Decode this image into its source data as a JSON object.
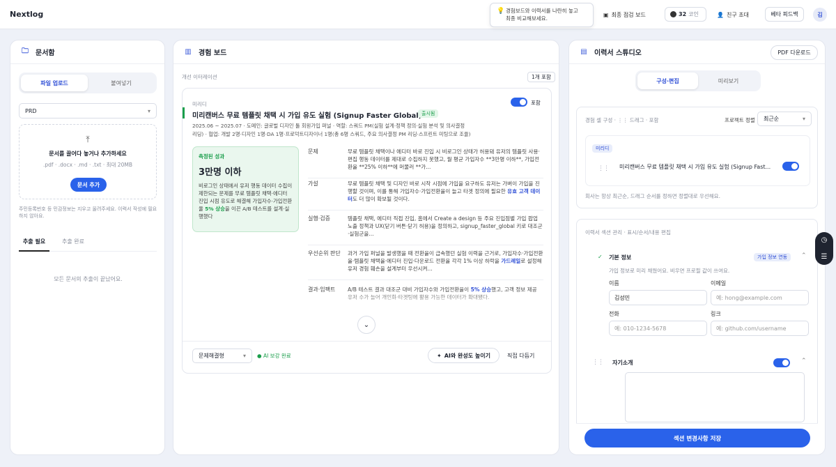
{
  "app": {
    "title": "Nextlog"
  },
  "topbar": {
    "tooltip_line1": "경험보드와 이력서를 나란히 놓고",
    "tooltip_line2": "최종 비교해보세요.",
    "final_check_board": "최종 점검 보드",
    "coins_count": "32",
    "coins_label": "코인",
    "invite_friend": "친구 초대",
    "beta_feedback": "베타 피드백",
    "avatar_initial": "김"
  },
  "library": {
    "title": "문서함",
    "tab_upload": "파일 업로드",
    "tab_paste": "붙여넣기",
    "doc_type": "PRD",
    "drop_title": "문서를 끌어다 놓거나 추가하세요",
    "drop_formats": ".pdf · .docx · .md · .txt · 최대 20MB",
    "add_doc_button": "문서 추가",
    "privacy_note": "주민등록번호 등 민감정보는 지우고 올려주세요. 이력서 작성에 필요하지 않아요.",
    "tab_needs_extraction": "추출 필요",
    "tab_extracted": "추출 완료",
    "empty_message": "모든 문서의 추출이 끝났어요."
  },
  "board": {
    "title": "경험 보드",
    "section_label": "개선 이터레이션",
    "included_count": "1개 포함",
    "card": {
      "small_label": "미리디",
      "include_label": "포함",
      "title": "미리캔버스 무료 템플릿 채택 시 가입 유도 실험 (Signup Faster Global)",
      "status_badge": "출시됨",
      "meta_line1": "2025.06 ~ 2025.07 · 도메인: 글로벌 디자인 툴 회원가입 퍼널 · 역할: 스쿼드 PM(실험 설계·정책 정의·실험 분석 및 의사결정",
      "meta_line2": "리딩) · 협업: 개발 2명·디자인 1명·DA 1명·프로덕트디자이너 1명(총 6명 스쿼드, 주요 의사결정 PM 리딩·스프린트 미팅으로 조율)",
      "metric_label": "측정된 성과",
      "metric_value": "3만명 이하",
      "metric_desc_pre": "비로그인 상태에서 유저 행동 데이터 수집이 제한되는 문제를 무료 템플릿 채택·에디터 진입 시점 유도로 해결해 가입자수·가입전환율 ",
      "metric_desc_hl": "5% 상승",
      "metric_desc_post": "을 이끈 A/B 테스트를 설계·실행했다",
      "rows": [
        {
          "label": "문제",
          "pre": "무료 템플릿 채택이나 에디터 바로 진입 시 비로그인 상태가 허용돼 유저의 템플릿 사용·편집 행동 데이터를 제대로 수집하지 못했고, 월 평균 가입자수 **3만명 이하**, 가입전환율 **25% 이하**에 머물러 **가...",
          "hl": "",
          "post": ""
        },
        {
          "label": "가설",
          "pre": "무료 템플릿 채택 및 디자인 바로 시작 시점에 가입을 요구하도 유저는 가벼이 가입을 진행할 것이며, 이를 통해 가입자수·가입전환율이 늘고 타겟 정의에 필요한 ",
          "hl": "유효 고객 데이터",
          "post": "도 더 많이 확보될 것이다."
        },
        {
          "label": "실행·검증",
          "pre": "템플릿 채택, 에디터 직접 진입, 홈에서 Create a design 등 주요 진입점별 가입 팝업 노출 정책과 UX(닫기 버튼·닫기 허용)을 정의하고, signup_faster_global 키로 대조군·실험군을...",
          "hl": "",
          "post": ""
        },
        {
          "label": "우선순위 판단",
          "pre": "과거 가입 퍼널을 발생했을 때 전환율이 급속했던 실험 이력을 근거로, 가입자수·가입전환율·템플릿 채택율·에디터 진입·다운로드 전환율 각각 1% 이상 하락을 ",
          "hl": "가드레일",
          "post": "로 설정해 유저 경험 훼손을 설계부터 우선시켜..."
        },
        {
          "label": "결과·임팩트",
          "pre": "A/B 테스트 결과 대조군 대비 가입자수와 가입전환율이 ",
          "hl": "5% 상승",
          "post": "했고, 고객 정보 제공 유저 수가 늘어 개인화·타겟팅에 활용 가능한 데이터가 확대됐다."
        }
      ],
      "category_select": "문제해결형",
      "ai_status": "AI 보강 완료",
      "ai_improve_button": "AI와 완성도 높이기",
      "edit_button": "직접 다듬기"
    }
  },
  "resume": {
    "title": "이력서 스튜디오",
    "pdf_button": "PDF 다운로드",
    "tab_compose": "구성·편집",
    "tab_preview": "미리보기",
    "compose_label": "경험 셀 구성 · ⋮⋮ 드래그 · 포함",
    "sort_label": "프로젝트 정렬",
    "sort_value": "최근순",
    "company_badge": "미리디",
    "selected_exp": "미리캔버스 무료 템플릿 채택 시 가입 유도 실험 (Signup Fast...",
    "order_note": "회사는 항상 최근순, 드래그 순서를 정하면 정렬대로 우선해요.",
    "section_manage_label": "이력서 섹션 관리 · 표시/순서/내용 편집",
    "basic_info": {
      "title": "기본 정보",
      "sync_badge": "가입 정보 연동",
      "hint": "가입 정보로 미리 채웠어요. 비우면 프로필 값이 쓰여요.",
      "name_label": "이름",
      "name_value": "김성민",
      "email_label": "이메일",
      "email_placeholder": "예: hong@example.com",
      "phone_label": "전화",
      "phone_placeholder": "예: 010-1234-5678",
      "link_label": "링크",
      "link_placeholder": "예: github.com/username"
    },
    "intro_title": "자기소개",
    "save_button": "섹션 변경사항 저장"
  },
  "colors": {
    "accent": "#2a62ea",
    "success": "#1a9e4b",
    "metric_bg": "#eaf7ee"
  }
}
